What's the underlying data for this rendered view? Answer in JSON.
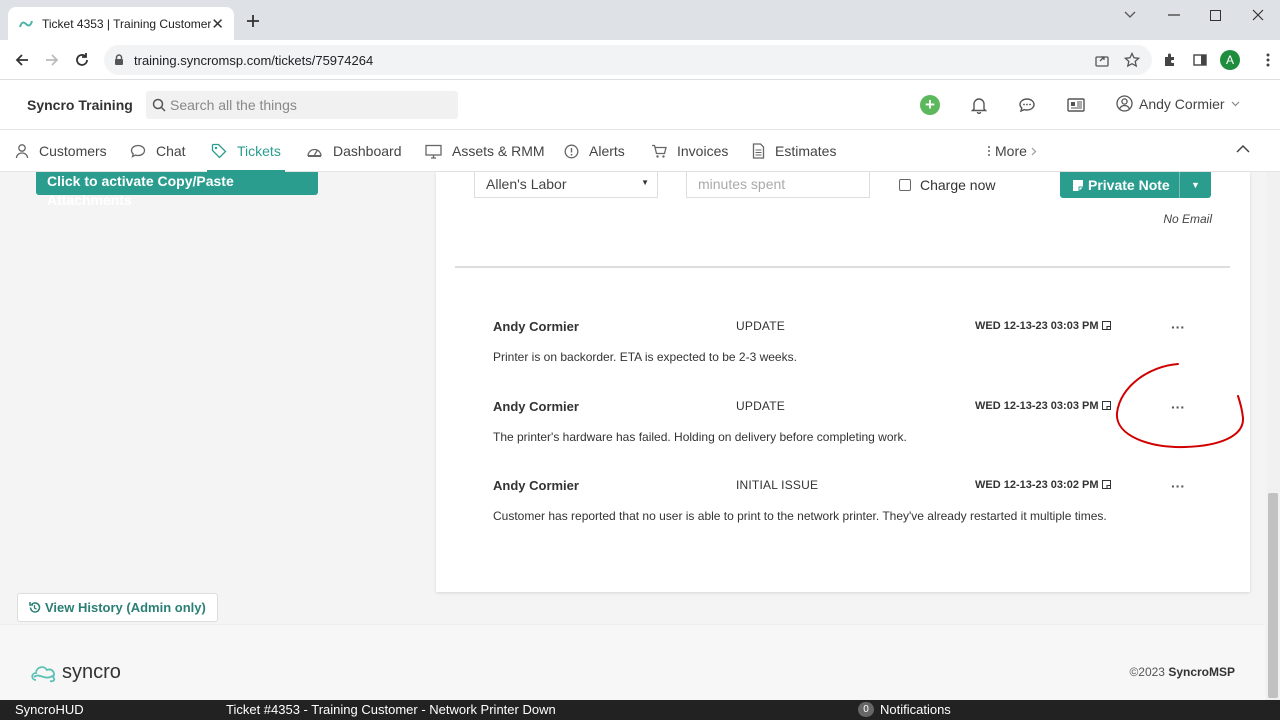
{
  "browser": {
    "tab_title": "Ticket 4353 | Training Customer",
    "url": "training.syncromsp.com/tickets/75974264",
    "profile_initial": "A"
  },
  "header": {
    "brand": "Syncro Training",
    "search_placeholder": "Search all the things",
    "user_name": "Andy Cormier"
  },
  "nav": {
    "items": [
      {
        "label": "Customers",
        "icon": "person-icon"
      },
      {
        "label": "Chat",
        "icon": "chat-icon"
      },
      {
        "label": "Tickets",
        "icon": "tag-icon",
        "active": true
      },
      {
        "label": "Dashboard",
        "icon": "speedometer-icon"
      },
      {
        "label": "Assets & RMM",
        "icon": "monitor-icon"
      },
      {
        "label": "Alerts",
        "icon": "alert-icon"
      },
      {
        "label": "Invoices",
        "icon": "cart-icon"
      },
      {
        "label": "Estimates",
        "icon": "document-icon"
      }
    ],
    "more_label": "More"
  },
  "content": {
    "copy_paste_label": "Click to activate Copy/Paste Attachments",
    "labor_select_value": "Allen's Labor",
    "minutes_placeholder": "minutes spent",
    "charge_now_label": "Charge now",
    "private_note_label": "Private Note",
    "no_email_label": "No Email",
    "view_history_label": "View History (Admin only)"
  },
  "comments": [
    {
      "author": "Andy Cormier",
      "type": "UPDATE",
      "timestamp": "WED 12-13-23 03:03 PM",
      "body": "Printer is on backorder. ETA is expected to be 2-3 weeks."
    },
    {
      "author": "Andy Cormier",
      "type": "UPDATE",
      "timestamp": "WED 12-13-23 03:03 PM",
      "body": "The printer's hardware has failed. Holding on delivery before completing work."
    },
    {
      "author": "Andy Cormier",
      "type": "INITIAL ISSUE",
      "timestamp": "WED 12-13-23 03:02 PM",
      "body": "Customer has reported that no user is able to print to the network printer. They've already restarted it multiple times."
    }
  ],
  "footer": {
    "logo_text": "syncro",
    "copyright_prefix": "©2023 ",
    "copyright_brand": "SyncroMSP"
  },
  "statusbar": {
    "hud_label": "SyncroHUD",
    "ticket_label": "Ticket #4353 - Training Customer - Network Printer Down",
    "notification_count": "0",
    "notifications_label": "Notifications"
  },
  "colors": {
    "accent": "#2a9d8f",
    "annotation": "#d00000"
  }
}
